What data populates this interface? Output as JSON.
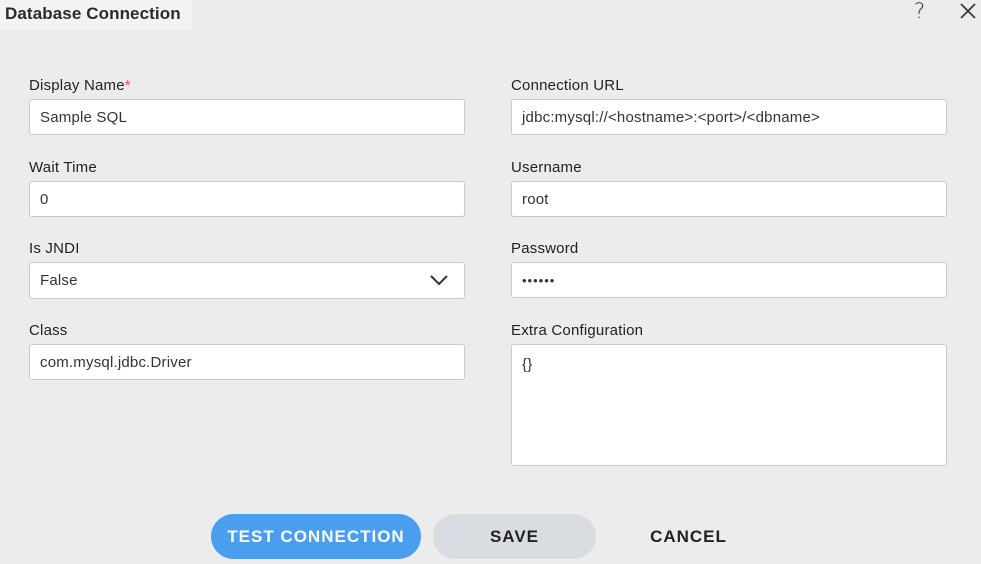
{
  "dialog": {
    "title": "Database Connection",
    "help_icon": "help-icon",
    "help_glyph": "?",
    "close_icon": "close-icon"
  },
  "form": {
    "display_name": {
      "label": "Display Name",
      "required_mark": "*",
      "value": "Sample SQL"
    },
    "wait_time": {
      "label": "Wait Time",
      "value": "0"
    },
    "is_jndi": {
      "label": "Is JNDI",
      "value": "False",
      "icon": "chevron-down-icon"
    },
    "class": {
      "label": "Class",
      "value": "com.mysql.jdbc.Driver"
    },
    "connection_url": {
      "label": "Connection URL",
      "value": "jdbc:mysql://<hostname>:<port>/<dbname>"
    },
    "username": {
      "label": "Username",
      "value": "root"
    },
    "password": {
      "label": "Password",
      "value": "••••••"
    },
    "extra_configuration": {
      "label": "Extra Configuration",
      "value": "{}"
    }
  },
  "buttons": {
    "test_connection": "TEST CONNECTION",
    "save": "SAVE",
    "cancel": "CANCEL"
  },
  "colors": {
    "background": "#ececec",
    "primary": "#4a9eef",
    "secondary": "#d9dde1",
    "required": "#e05050"
  }
}
